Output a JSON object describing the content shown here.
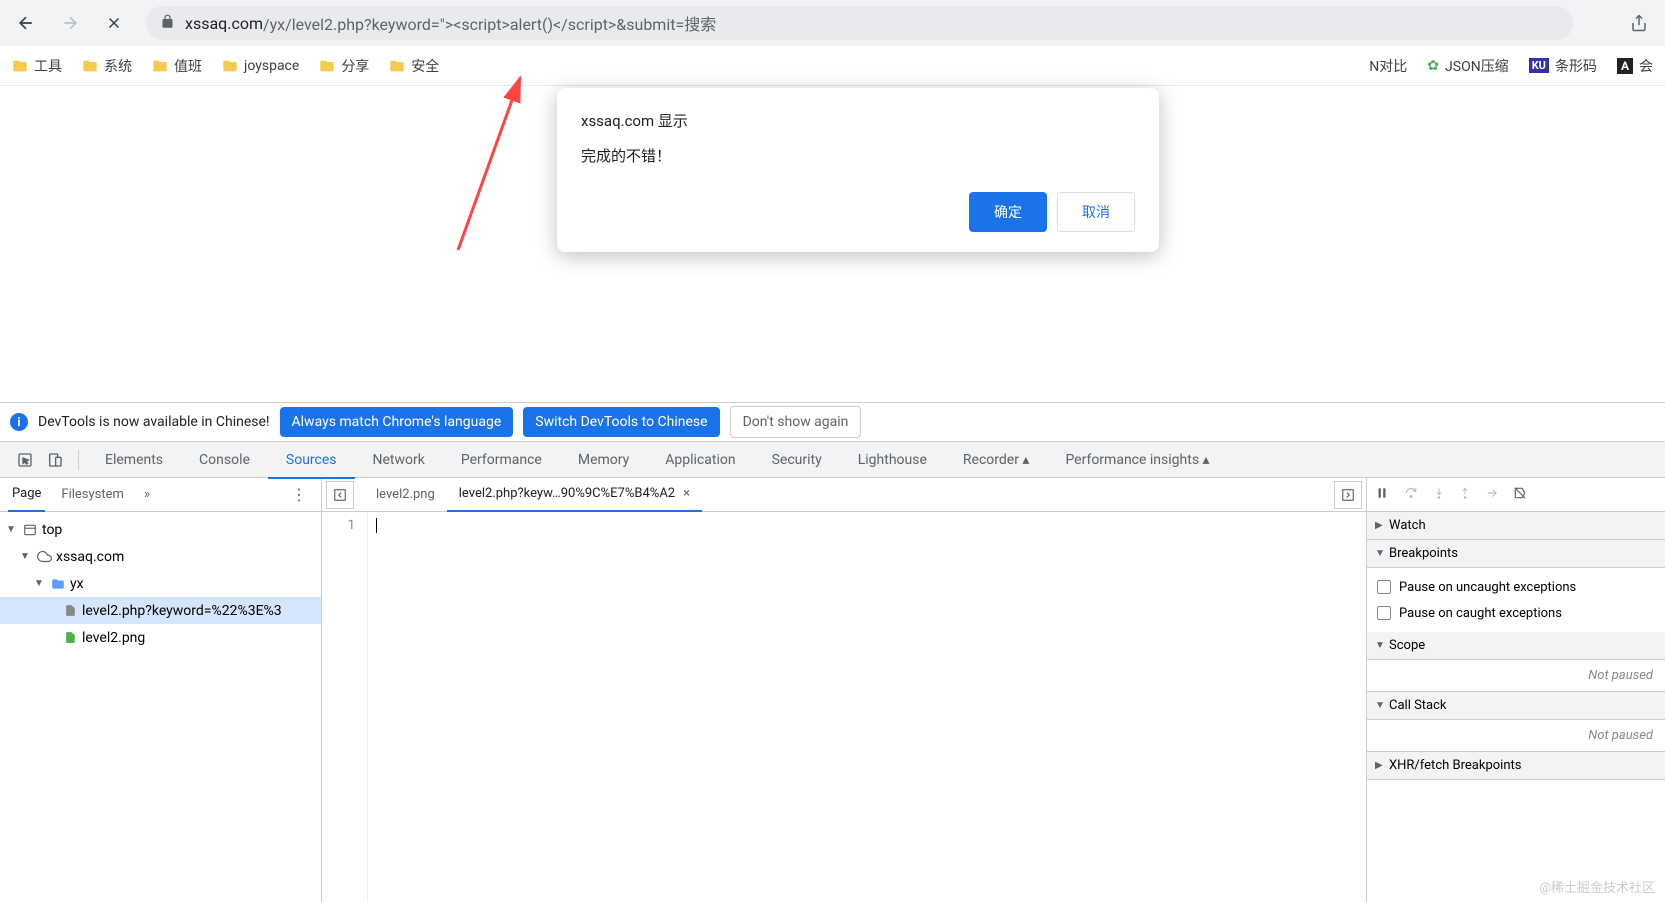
{
  "addressbar": {
    "url_host": "xssaq.com",
    "url_path": "/yx/level2.php?keyword=\"><script>alert()</script>&submit=搜索"
  },
  "bookmarks": {
    "left": [
      "工具",
      "系统",
      "值班",
      "joyspace",
      "分享",
      "安全"
    ],
    "right_partial": "N对比",
    "json_compress": "JSON压缩",
    "barcode": "条形码",
    "meeting": "会"
  },
  "alert_dialog": {
    "title": "xssaq.com 显示",
    "message": "完成的不错！",
    "ok": "确定",
    "cancel": "取消"
  },
  "banner": {
    "text": "DevTools is now available in Chinese!",
    "always_match": "Always match Chrome's language",
    "switch": "Switch DevTools to Chinese",
    "dont_show": "Don't show again"
  },
  "devtools_tabs": [
    "Elements",
    "Console",
    "Sources",
    "Network",
    "Performance",
    "Memory",
    "Application",
    "Security",
    "Lighthouse",
    "Recorder ▴",
    "Performance insights ▴"
  ],
  "devtools_active_tab": "Sources",
  "sources": {
    "subtabs": {
      "page": "Page",
      "filesystem": "Filesystem",
      "more": "»"
    },
    "tree": {
      "top": "top",
      "domain": "xssaq.com",
      "folder": "yx",
      "file_php": "level2.php?keyword=%22%3E%3",
      "file_png": "level2.png"
    },
    "open_files": {
      "png": "level2.png",
      "php": "level2.php?keyw…90%9C%E7%B4%A2"
    },
    "line_number": "1"
  },
  "debugger": {
    "watch": "Watch",
    "breakpoints": "Breakpoints",
    "pause_uncaught": "Pause on uncaught exceptions",
    "pause_caught": "Pause on caught exceptions",
    "scope": "Scope",
    "not_paused": "Not paused",
    "call_stack": "Call Stack",
    "xhr": "XHR/fetch Breakpoints"
  },
  "watermark": "@稀土掘金技术社区"
}
